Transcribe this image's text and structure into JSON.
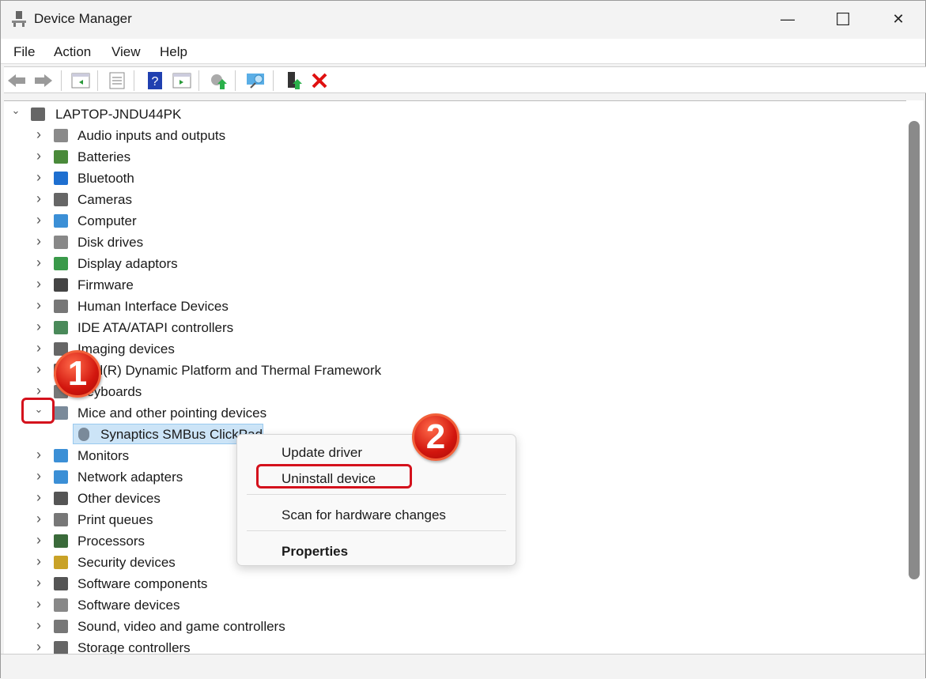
{
  "window": {
    "title": "Device Manager",
    "minimize": "—",
    "maximize": "☐",
    "close": "✕"
  },
  "menu": [
    "File",
    "Action",
    "View",
    "Help"
  ],
  "toolbar": [
    "back-icon",
    "forward-icon",
    "show-hide-console-tree-icon",
    "properties-icon",
    "help-icon",
    "action-pane-icon",
    "update-driver-icon",
    "scan-hardware-icon",
    "enable-device-icon",
    "uninstall-device-icon"
  ],
  "tree": {
    "root": "LAPTOP-JNDU44PK",
    "categories": [
      {
        "label": "Audio inputs and outputs",
        "color": "#8a8a8a"
      },
      {
        "label": "Batteries",
        "color": "#4a8a3a"
      },
      {
        "label": "Bluetooth",
        "color": "#1e6fd0"
      },
      {
        "label": "Cameras",
        "color": "#666666"
      },
      {
        "label": "Computer",
        "color": "#3b8fd6"
      },
      {
        "label": "Disk drives",
        "color": "#888888"
      },
      {
        "label": "Display adaptors",
        "color": "#3a9a4a"
      },
      {
        "label": "Firmware",
        "color": "#444444"
      },
      {
        "label": "Human Interface Devices",
        "color": "#777777"
      },
      {
        "label": "IDE ATA/ATAPI controllers",
        "color": "#4a8a5a"
      },
      {
        "label": "Imaging devices",
        "color": "#666666"
      },
      {
        "label": "Intel(R) Dynamic Platform and Thermal Framework",
        "color": "#555555"
      },
      {
        "label": "Keyboards",
        "color": "#777777"
      },
      {
        "label": "Mice and other pointing devices",
        "color": "#7a8a9a",
        "expanded": true,
        "children": [
          "Synaptics SMBus ClickPad"
        ]
      },
      {
        "label": "Monitors",
        "color": "#3b8fd6"
      },
      {
        "label": "Network adapters",
        "color": "#3b8fd6"
      },
      {
        "label": "Other devices",
        "color": "#555555"
      },
      {
        "label": "Print queues",
        "color": "#777777"
      },
      {
        "label": "Processors",
        "color": "#3a6a3a"
      },
      {
        "label": "Security devices",
        "color": "#c9a227"
      },
      {
        "label": "Software components",
        "color": "#555555"
      },
      {
        "label": "Software devices",
        "color": "#888888"
      },
      {
        "label": "Sound, video and game controllers",
        "color": "#777777"
      },
      {
        "label": "Storage controllers",
        "color": "#666666"
      }
    ]
  },
  "context_menu": {
    "update": "Update driver",
    "uninstall": "Uninstall device",
    "scan": "Scan for hardware changes",
    "properties": "Properties"
  },
  "annotations": {
    "step1": "1",
    "step2": "2"
  },
  "colors": {
    "highlight": "#d4111c",
    "selection": "#cce4f7"
  }
}
